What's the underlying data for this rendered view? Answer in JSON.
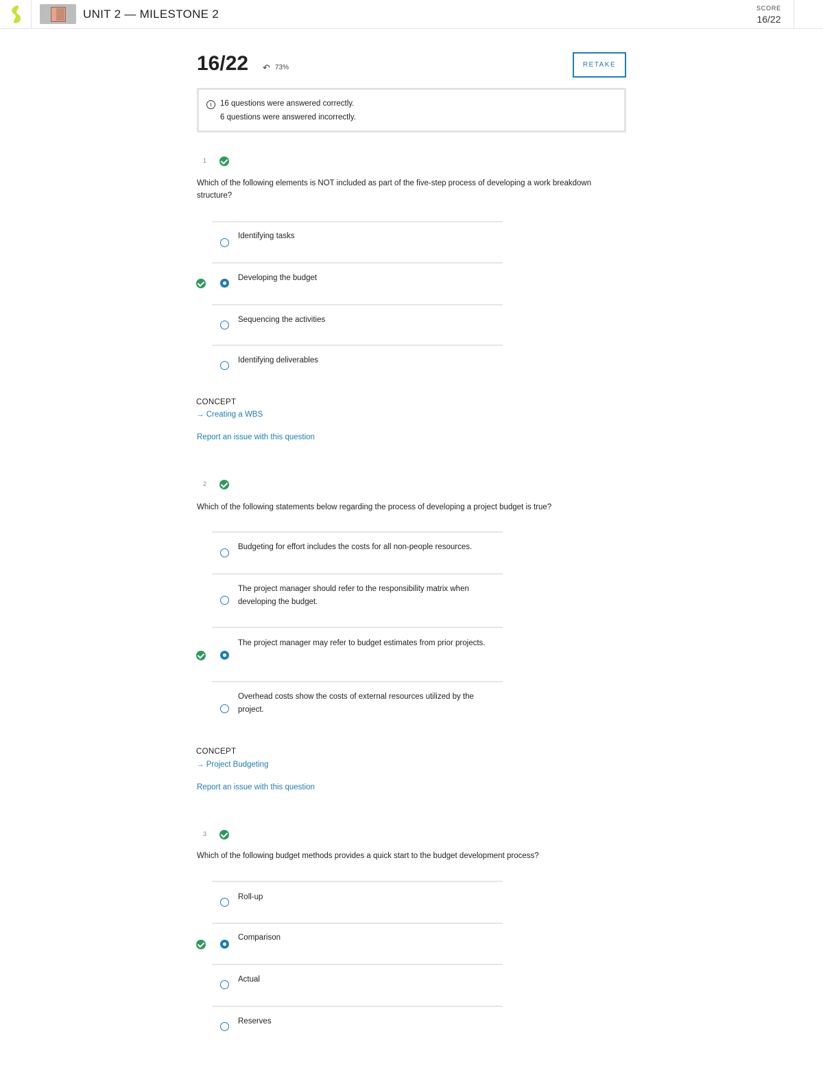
{
  "header": {
    "title": "UNIT 2 — MILESTONE 2",
    "score_label": "SCORE",
    "score_value": "16/22"
  },
  "summary": {
    "big_score": "16/22",
    "percent": "73%",
    "retake_label": "RETAKE",
    "correct_line": "16 questions were answered correctly.",
    "incorrect_line": "6 questions were answered incorrectly."
  },
  "colors": {
    "accent": "#1e7db4",
    "correct": "#2e9a5d",
    "logo": "#c8e23a"
  },
  "questions": [
    {
      "number": "1",
      "text": "Which of the following elements is NOT included as part of the five-step process of developing a work breakdown structure?",
      "options": [
        {
          "text": "Identifying tasks",
          "selected": false,
          "correct": false
        },
        {
          "text": "Developing the budget",
          "selected": true,
          "correct": true
        },
        {
          "text": "Sequencing the activities",
          "selected": false,
          "correct": false
        },
        {
          "text": "Identifying deliverables",
          "selected": false,
          "correct": false
        }
      ],
      "concept_label": "CONCEPT",
      "concept_link": "→ Creating a WBS",
      "report": "Report an issue with this question"
    },
    {
      "number": "2",
      "text": "Which of the following statements below regarding the process of developing a project budget is true?",
      "options": [
        {
          "text": "Budgeting for effort includes the costs for all non-people resources.",
          "selected": false,
          "correct": false
        },
        {
          "text": "The project manager should refer to the responsibility matrix when developing the budget.",
          "selected": false,
          "correct": false
        },
        {
          "text": "The project manager may refer to budget estimates from prior projects.",
          "selected": true,
          "correct": true
        },
        {
          "text": "Overhead costs show the costs of external resources utilized by the project.",
          "selected": false,
          "correct": false
        }
      ],
      "concept_label": "CONCEPT",
      "concept_link": "→ Project Budgeting",
      "report": "Report an issue with this question"
    },
    {
      "number": "3",
      "text": "Which of the following budget methods provides a quick start to the budget development process?",
      "options": [
        {
          "text": "Roll-up",
          "selected": false,
          "correct": false
        },
        {
          "text": "Comparison",
          "selected": true,
          "correct": true
        },
        {
          "text": "Actual",
          "selected": false,
          "correct": false
        },
        {
          "text": "Reserves",
          "selected": false,
          "correct": false
        }
      ]
    }
  ]
}
